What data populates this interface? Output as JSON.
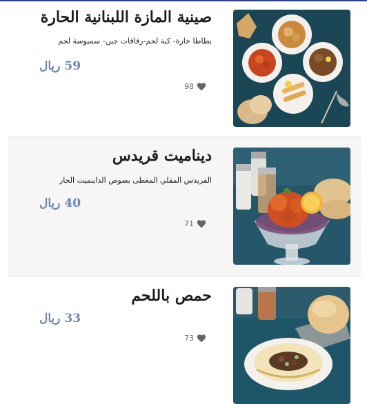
{
  "colors": {
    "accent": "#2d3f8a",
    "price": "#6d86b5",
    "heart": "#666666"
  },
  "items": [
    {
      "title": "صينية المازة اللبنانية الحارة",
      "description": "بطاطا حارة- كبة لحم-رقاقات جبن- سمبوسة لحم",
      "price": "59 ريال",
      "likes": "98",
      "like_icon": "heart-icon"
    },
    {
      "title": "ديناميت قريدس",
      "description": "القريدس المقلي المغطى بصوص الداينميت الحار",
      "price": "40 ريال",
      "likes": "71",
      "like_icon": "heart-icon"
    },
    {
      "title": "حمص باللحم",
      "description": "",
      "price": "33 ريال",
      "likes": "73",
      "like_icon": "heart-icon"
    }
  ]
}
